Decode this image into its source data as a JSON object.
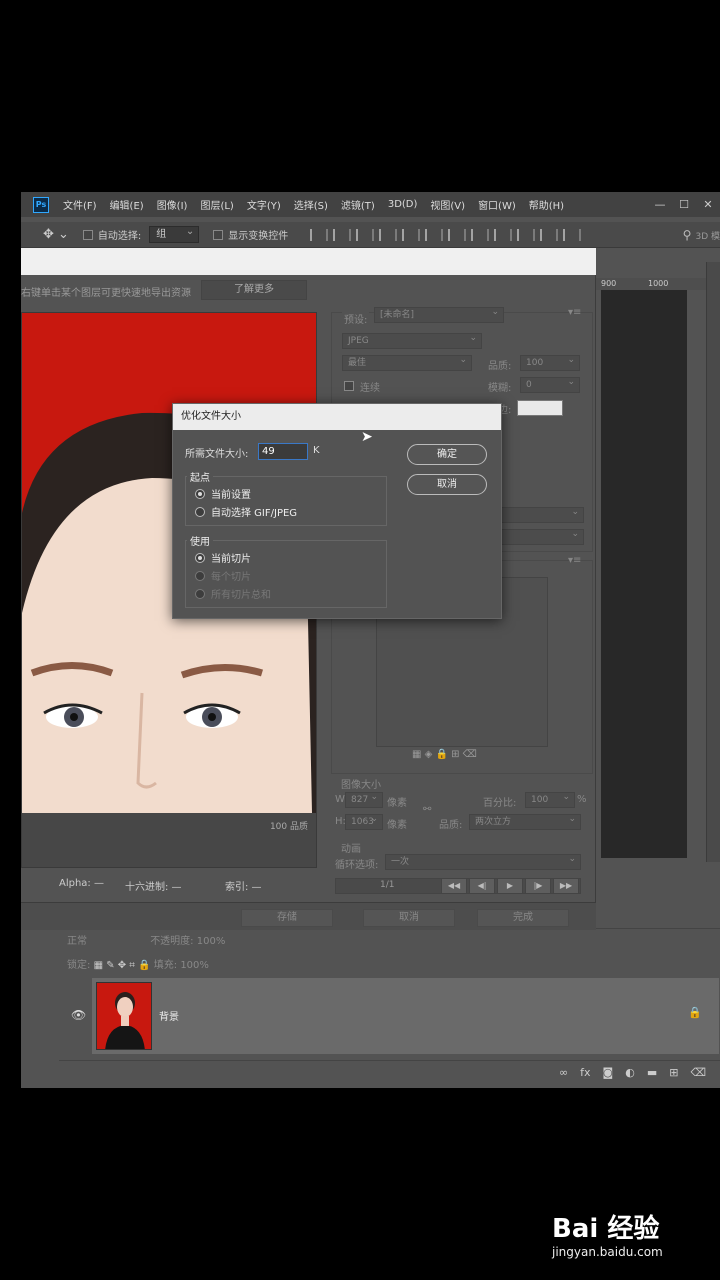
{
  "menubar": {
    "logo": "Ps",
    "items": [
      "文件(F)",
      "编辑(E)",
      "图像(I)",
      "图层(L)",
      "文字(Y)",
      "选择(S)",
      "滤镜(T)",
      "3D(D)",
      "视图(V)",
      "窗口(W)",
      "帮助(H)"
    ],
    "min": "—",
    "max": "☐",
    "close": "✕"
  },
  "options": {
    "auto_select_label": "自动选择:",
    "group_value": "组",
    "show_transform_label": "显示变换控件",
    "mode_3d": "3D 模"
  },
  "ruler": {
    "t900": "900",
    "t1000": "1000"
  },
  "sfw": {
    "hint": "右键单击某个图层可更快速地导出资源",
    "learn_more": "了解更多",
    "preset_label": "预设:",
    "preset_value": "[未命名]",
    "format": "JPEG",
    "quality_preset": "最佳",
    "quality_label": "品质:",
    "quality_value": "100",
    "progressive": "连续",
    "blur_label": "模糊:",
    "blur_value": "0",
    "matte_label": "杂边:",
    "preview_quality": "100 品质",
    "image_size_hdr": "图像大小",
    "w_label": "W:",
    "w_value": "827",
    "w_unit": "像素",
    "h_label": "H:",
    "h_value": "1063",
    "h_unit": "像素",
    "percent_label": "百分比:",
    "percent_value": "100",
    "percent_unit": "%",
    "resample_label": "品质:",
    "resample_value": "两次立方",
    "animation_hdr": "动画",
    "loop_label": "循环选项:",
    "loop_value": "一次",
    "frame": "1/1",
    "status_alpha": "Alpha: —",
    "status_hex": "十六进制: —",
    "status_index": "索引: —",
    "save": "存储",
    "cancel": "取消",
    "done": "完成"
  },
  "optimize": {
    "title": "优化文件大小",
    "desired_label": "所需文件大小:",
    "desired_value": "49",
    "unit": "K",
    "ok": "确定",
    "cancel": "取消",
    "start_group": "起点",
    "start_current": "当前设置",
    "start_auto": "自动选择 GIF/JPEG",
    "use_group": "使用",
    "use_current": "当前切片",
    "use_each": "每个切片",
    "use_total": "所有切片总和"
  },
  "layers": {
    "blend": "正常",
    "opacity_label": "不透明度:",
    "opacity": "100%",
    "lock_label": "锁定:",
    "fill_label": "填充:",
    "fill": "100%",
    "layer_name": "背景"
  },
  "watermark": {
    "logo": "Bai 经验",
    "url": "jingyan.baidu.com"
  },
  "colors": {
    "accent": "#3a78c7",
    "bg_red": "#c8180f",
    "panel": "#535353"
  }
}
